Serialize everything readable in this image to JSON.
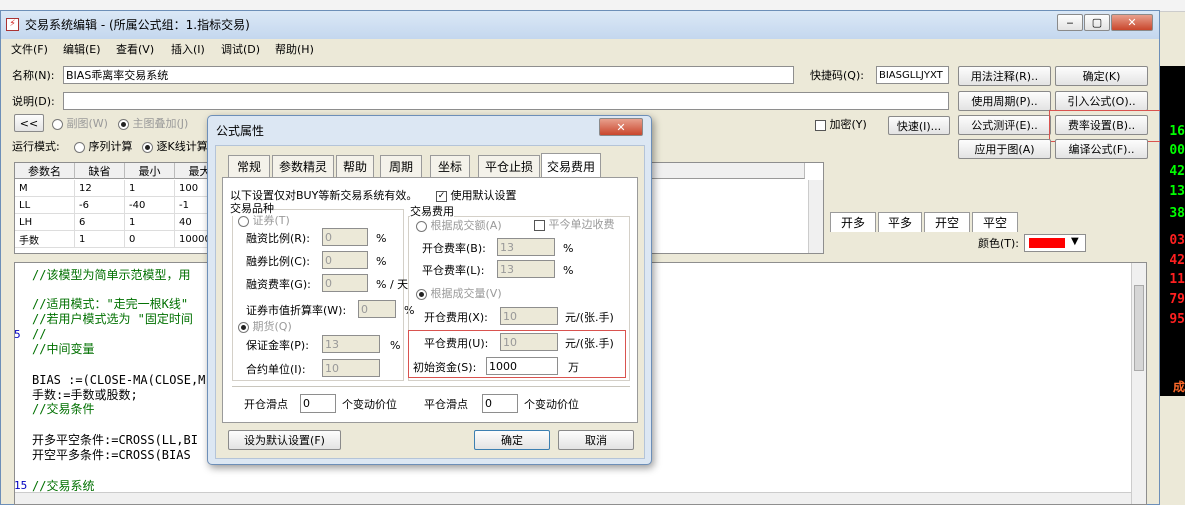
{
  "window": {
    "title": "交易系统编辑 - (所属公式组：1.指标交易)"
  },
  "menu": [
    "文件(F)",
    "编辑(E)",
    "查看(V)",
    "插入(I)",
    "调试(D)",
    "帮助(H)"
  ],
  "form": {
    "name_label": "名称(N):",
    "name_value": "BIAS乖离率交易系统",
    "shortcut_label": "快捷码(Q):",
    "shortcut_value": "BIASGLLJYXT",
    "desc_label": "说明(D):",
    "collapse": "<<",
    "subchart": "副图(W)",
    "mainchart": "主图叠加(J)",
    "encrypt": "加密(Y)",
    "quick": "快速(I)...",
    "run_mode_label": "运行模式:",
    "run_serial": "序列计算",
    "run_point": "逐K线计算"
  },
  "right_buttons": {
    "usage_note": "用法注释(R)..",
    "ok": "确定(K)",
    "use_period": "使用周期(P)..",
    "import": "引入公式(O)..",
    "test": "公式测评(E)..",
    "fee": "费率设置(B)..",
    "apply": "应用于图(A)",
    "compile": "编译公式(F).."
  },
  "params": {
    "headers": [
      "参数名",
      "缺省",
      "最小",
      "最大"
    ],
    "rows": [
      [
        "M",
        "12",
        "1",
        "100"
      ],
      [
        "LL",
        "-6",
        "-40",
        "-1"
      ],
      [
        "LH",
        "6",
        "1",
        "40"
      ],
      [
        "手数",
        "1",
        "0",
        "10000"
      ]
    ]
  },
  "right_tabs": [
    "开多",
    "平多",
    "开空",
    "平空"
  ],
  "color_label": "颜色(T):",
  "code_lines": [
    "//该模型为简单示范模型，用",
    "//适用模式：\"走完一根K线\"",
    "//若用户模式选为 \"固定时间",
    "//",
    "//中间变量",
    "BIAS :=(CLOSE-MA(CLOSE,M))",
    "手数:=手数或股数;",
    "//交易条件",
    "开多平空条件:=CROSS(LL,BI",
    "开空平多条件:=CROSS(BIAS",
    "//交易系统"
  ],
  "line_numbers": [
    "5",
    "15"
  ],
  "right_strip": [
    "16",
    "00",
    "42",
    "13",
    "38",
    "03",
    "42",
    "11",
    "79",
    "95",
    "成"
  ],
  "dialog": {
    "title": "公式属性",
    "tabs": [
      "常规",
      "参数精灵",
      "帮助",
      "周期",
      "坐标",
      "平仓止损",
      "交易费用"
    ],
    "note": "以下设置仅对BUY等新交易系统有效。",
    "use_default": "使用默认设置",
    "group_left": "交易品种",
    "group_right": "交易费用",
    "securities": "证券(T)",
    "finance_ratio": "融资比例(R):",
    "finance_ratio_v": "0",
    "loan_ratio": "融券比例(C):",
    "loan_ratio_v": "0",
    "finance_rate": "融资费率(G):",
    "finance_rate_v": "0",
    "pct": "%",
    "pct_day": "% / 天",
    "market_rate": "证券市值折算率(W):",
    "market_rate_v": "0",
    "futures": "期货(Q)",
    "margin": "保证金率(P):",
    "margin_v": "13",
    "unit": "合约单位(I):",
    "unit_v": "10",
    "by_amount": "根据成交额(A)",
    "close_single": "平今单边收费",
    "open_rate": "开仓费率(B):",
    "open_rate_v": "13",
    "close_rate": "平仓费率(L):",
    "close_rate_v": "13",
    "by_volume": "根据成交量(V)",
    "open_fee": "开仓费用(X):",
    "open_fee_v": "10",
    "close_fee": "平仓费用(U):",
    "close_fee_v": "10",
    "per_unit": "元/(张.手)",
    "init_capital": "初始资金(S):",
    "init_capital_v": "1000",
    "wan": "万",
    "open_slip": "开仓滑点",
    "open_slip_v": "0",
    "close_slip": "平仓滑点",
    "close_slip_v": "0",
    "tick_unit": "个变动价位",
    "set_default": "设为默认设置(F)",
    "ok": "确定",
    "cancel": "取消"
  }
}
